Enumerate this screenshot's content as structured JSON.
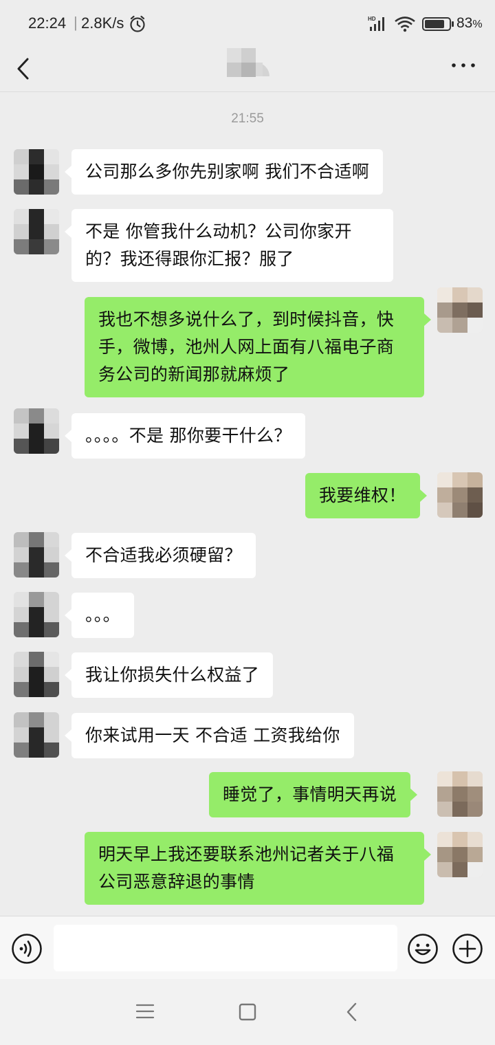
{
  "status_bar": {
    "time": "22:24",
    "separator": "|",
    "network_speed": "2.8K/s",
    "battery_percent": "83",
    "battery_unit": "%",
    "icons": [
      "alarm-icon",
      "hd-signal-icon",
      "wifi-icon",
      "battery-icon"
    ]
  },
  "nav": {
    "back_icon": "back-arrow-icon",
    "more_icon": "more-icon"
  },
  "chat": {
    "timestamp": "21:55",
    "messages": [
      {
        "side": "left",
        "text": "公司那么多你先别家啊 我们不合适啊"
      },
      {
        "side": "left",
        "text": "不是 你管我什么动机？公司你家开的？我还得跟你汇报？服了"
      },
      {
        "side": "right",
        "text": "我也不想多说什么了，到时候抖音，快手，微博，池州人网上面有八福电子商务公司的新闻那就麻烦了"
      },
      {
        "side": "left",
        "text": "。。。。不是 那你要干什么？"
      },
      {
        "side": "right",
        "text": "我要维权！"
      },
      {
        "side": "left",
        "text": "不合适我必须硬留？"
      },
      {
        "side": "left",
        "text": "。。。"
      },
      {
        "side": "left",
        "text": "我让你损失什么权益了"
      },
      {
        "side": "left",
        "text": "你来试用一天 不合适 工资我给你"
      },
      {
        "side": "right",
        "text": "睡觉了，事情明天再说"
      },
      {
        "side": "right",
        "text": "明天早上我还要联系池州记者关于八福公司恶意辞退的事情"
      }
    ]
  },
  "input_bar": {
    "placeholder": "",
    "value": "",
    "icons": [
      "voice-icon",
      "emoji-icon",
      "plus-icon"
    ]
  },
  "system_nav": {
    "icons": [
      "menu-icon",
      "home-icon",
      "back-icon"
    ]
  },
  "colors": {
    "background": "#ededed",
    "bubble_left": "#ffffff",
    "bubble_right": "#95ec69",
    "text": "#111111",
    "timestamp": "#9a9a9a"
  }
}
